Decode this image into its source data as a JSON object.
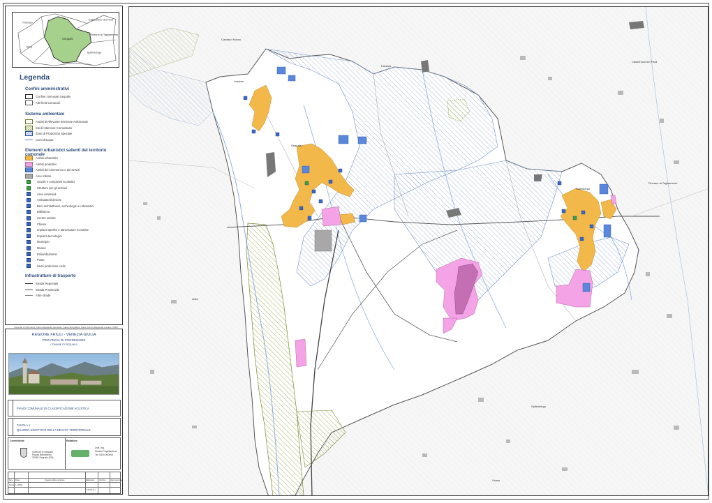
{
  "locator_map": {
    "places": [
      "Travesio",
      "Castelnovo del Friuli",
      "Pinzano al Tagliamento",
      "Sequals",
      "Arba",
      "Spilimbergo"
    ]
  },
  "legend": {
    "title": "Legenda",
    "sections": [
      {
        "title": "Confini amministrativi",
        "items": [
          {
            "label": "Confine comunale Sequals",
            "symbol": "box-thick"
          },
          {
            "label": "Altri limiti comunali",
            "symbol": "box-thin"
          }
        ]
      },
      {
        "title": "Sistema ambientale",
        "items": [
          {
            "label": "Ambiti di Rilevante Interesse Ambientale",
            "symbol": "box-green"
          },
          {
            "label": "Siti di Interesse Comunitario",
            "symbol": "hatch-green"
          },
          {
            "label": "Zone di Protezione Speciale",
            "symbol": "hatch-blue"
          },
          {
            "label": "Corsi d'acqua",
            "symbol": "line-blue"
          }
        ]
      },
      {
        "title": "Elementi urbanistici salienti del territorio comunale",
        "items": [
          {
            "label": "Ambiti urbanistici",
            "symbol": "fill-orange"
          },
          {
            "label": "Ambiti produttivi",
            "symbol": "fill-pink"
          },
          {
            "label": "Ambiti del commercio e dei servizi",
            "symbol": "fill-blue"
          },
          {
            "label": "Aree militari",
            "symbol": "fill-grey"
          },
          {
            "label": "Scuole e complessi scolastici",
            "symbol": "icon-green"
          },
          {
            "label": "Strutture per gli anziani",
            "symbol": "icon-green"
          },
          {
            "label": "Aree cimiteriali",
            "symbol": "icon"
          },
          {
            "label": "Ambulatori/cliniche",
            "symbol": "icon"
          },
          {
            "label": "Beni architettonici, archeologici e urbanistici",
            "symbol": "icon"
          },
          {
            "label": "Biblioteca",
            "symbol": "icon"
          },
          {
            "label": "Centro sociale",
            "symbol": "icon"
          },
          {
            "label": "Chiese",
            "symbol": "icon"
          },
          {
            "label": "Impianti sportivi e attrezzature ricreative",
            "symbol": "icon"
          },
          {
            "label": "Impianti tecnologici",
            "symbol": "icon"
          },
          {
            "label": "Municipio",
            "symbol": "icon"
          },
          {
            "label": "Museo",
            "symbol": "icon"
          },
          {
            "label": "Poliambulatorio",
            "symbol": "icon"
          },
          {
            "label": "Poste",
            "symbol": "icon"
          },
          {
            "label": "Sede protezione civile",
            "symbol": "icon"
          }
        ]
      },
      {
        "title": "Infrastrutture di trasporto",
        "items": [
          {
            "label": "Strada Regionale",
            "symbol": "line-thick"
          },
          {
            "label": "Strada Provinciale",
            "symbol": "line-mid"
          },
          {
            "label": "Altre strade",
            "symbol": "line-thin"
          }
        ]
      }
    ],
    "source_note": "Sorgente di riferimento: Piano Regolatore Generale - base cartografica: Carta Tecnica Regionale a scala 1:5000"
  },
  "title_block": {
    "region": "REGIONE FRIULI - VENEZIA GIULIA",
    "province": "PROVINCIA DI PORDENONE",
    "comune": "COMUNE DI SEQUALS",
    "project": "PIANO COMUNALE DI CLASSIFICAZIONE ACUSTICA",
    "tavola": "TAVOLA 1",
    "tavola_subtitle": "QUADRO SINOTTICO DELLA REALTA' TERRITORIALE",
    "committente_heading": "Committente",
    "redattore_heading": "Redattore",
    "committente_lines": [
      "Comune di Sequals",
      "Piazza Bernardino",
      "33090 Sequals (PN)"
    ],
    "redattore_lines": [
      "Dott. Ing.",
      "Studio Progettazione",
      "Tel. 0434 000000"
    ],
    "table_header": [
      "Rev.",
      "Data",
      "Oggetto della revisione",
      "Elaborato",
      "Verifica",
      "Approvazione"
    ],
    "scale_label": "Scala",
    "scale_value": "1:10000",
    "tavola_cell": "TAVOLA 1"
  },
  "map": {
    "place_labels": [
      "Lestans",
      "Sequals",
      "Solimbergo",
      "Travesio",
      "Arba",
      "Spilimbergo",
      "Vivaro",
      "Castelnovo del Friuli",
      "Cavasso Nuovo",
      "Pinzano al Tagliamento"
    ]
  }
}
